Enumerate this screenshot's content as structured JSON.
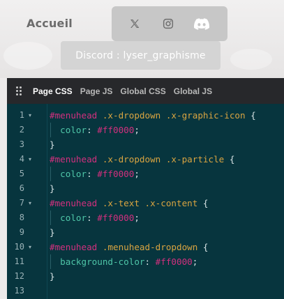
{
  "site": {
    "nav_home": "Accueil",
    "social": [
      {
        "name": "x",
        "icon": "x-logo-icon"
      },
      {
        "name": "instagram",
        "icon": "instagram-icon"
      },
      {
        "name": "discord",
        "icon": "discord-icon"
      }
    ],
    "tooltip": "Discord : lyser_graphisme"
  },
  "editor": {
    "tabs": [
      {
        "label": "Page CSS",
        "active": true
      },
      {
        "label": "Page JS",
        "active": false
      },
      {
        "label": "Global CSS",
        "active": false
      },
      {
        "label": "Global JS",
        "active": false
      }
    ],
    "lines": [
      {
        "n": "1",
        "fold": true,
        "tokens": [
          [
            "id",
            "#menuhead"
          ],
          [
            "punc",
            " "
          ],
          [
            "cls",
            ".x-dropdown"
          ],
          [
            "punc",
            " "
          ],
          [
            "cls",
            ".x-graphic-icon"
          ],
          [
            "punc",
            " {"
          ]
        ]
      },
      {
        "n": "2",
        "fold": false,
        "indent": true,
        "tokens": [
          [
            "prop",
            "color"
          ],
          [
            "punc",
            ": "
          ],
          [
            "val",
            "#ff0000"
          ],
          [
            "punc",
            ";"
          ]
        ]
      },
      {
        "n": "3",
        "fold": false,
        "tokens": [
          [
            "punc",
            "}"
          ]
        ]
      },
      {
        "n": "4",
        "fold": true,
        "tokens": [
          [
            "id",
            "#menuhead"
          ],
          [
            "punc",
            " "
          ],
          [
            "cls",
            ".x-dropdown"
          ],
          [
            "punc",
            " "
          ],
          [
            "cls",
            ".x-particle"
          ],
          [
            "punc",
            " {"
          ]
        ]
      },
      {
        "n": "5",
        "fold": false,
        "indent": true,
        "tokens": [
          [
            "prop",
            "color"
          ],
          [
            "punc",
            ": "
          ],
          [
            "val",
            "#ff0000"
          ],
          [
            "punc",
            ";"
          ]
        ]
      },
      {
        "n": "6",
        "fold": false,
        "tokens": [
          [
            "punc",
            "}"
          ]
        ]
      },
      {
        "n": "7",
        "fold": true,
        "tokens": [
          [
            "id",
            "#menuhead"
          ],
          [
            "punc",
            " "
          ],
          [
            "cls",
            ".x-text"
          ],
          [
            "punc",
            " "
          ],
          [
            "cls",
            ".x-content"
          ],
          [
            "punc",
            " {"
          ]
        ]
      },
      {
        "n": "8",
        "fold": false,
        "indent": true,
        "tokens": [
          [
            "prop",
            "color"
          ],
          [
            "punc",
            ": "
          ],
          [
            "val",
            "#ff0000"
          ],
          [
            "punc",
            ";"
          ]
        ]
      },
      {
        "n": "9",
        "fold": false,
        "tokens": [
          [
            "punc",
            "}"
          ]
        ]
      },
      {
        "n": "10",
        "fold": true,
        "tokens": [
          [
            "id",
            "#menuhead"
          ],
          [
            "punc",
            " "
          ],
          [
            "cls",
            ".menuhead-dropdown"
          ],
          [
            "punc",
            " {"
          ]
        ]
      },
      {
        "n": "11",
        "fold": false,
        "indent": true,
        "tokens": [
          [
            "prop",
            "background-color"
          ],
          [
            "punc",
            ": "
          ],
          [
            "val",
            "#ff0000"
          ],
          [
            "punc",
            ";"
          ]
        ]
      },
      {
        "n": "12",
        "fold": false,
        "tokens": [
          [
            "punc",
            "}"
          ]
        ]
      },
      {
        "n": "13",
        "fold": false,
        "tokens": []
      }
    ]
  }
}
